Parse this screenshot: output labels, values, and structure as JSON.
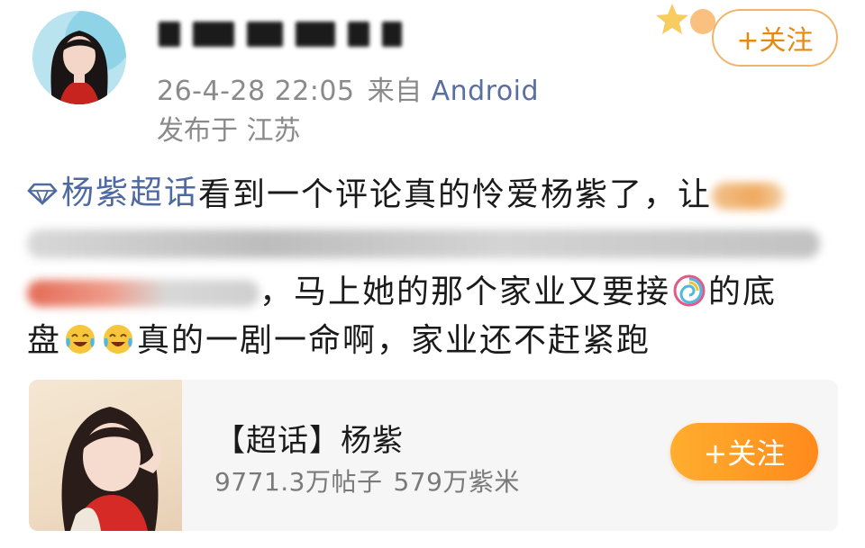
{
  "post_header": {
    "timestamp": "26-4-28 22:05",
    "source_prefix": "来自",
    "device": "Android",
    "location": "发布于 江苏",
    "follow_label": "+关注"
  },
  "post_body": {
    "topic": "杨紫超话",
    "line1_text": "看到一个评论真的怜爱杨紫了，让",
    "line3_text": "，马上她的那个家业又要接",
    "line3_tail": "的底",
    "line4_start": "盘",
    "line4_text": "真的一剧一命啊，家业还不赶紧跑"
  },
  "super_topic_card": {
    "title": "【超话】杨紫",
    "posts_count": "9771.3万帖子",
    "members_count": "579万紫米",
    "follow_label": "+关注"
  },
  "colors": {
    "topic_link": "#4f6aa0",
    "meta_gray": "#8a8a8a",
    "follow_orange": "#ff8a1c",
    "follow_outline": "#f0b56a"
  }
}
